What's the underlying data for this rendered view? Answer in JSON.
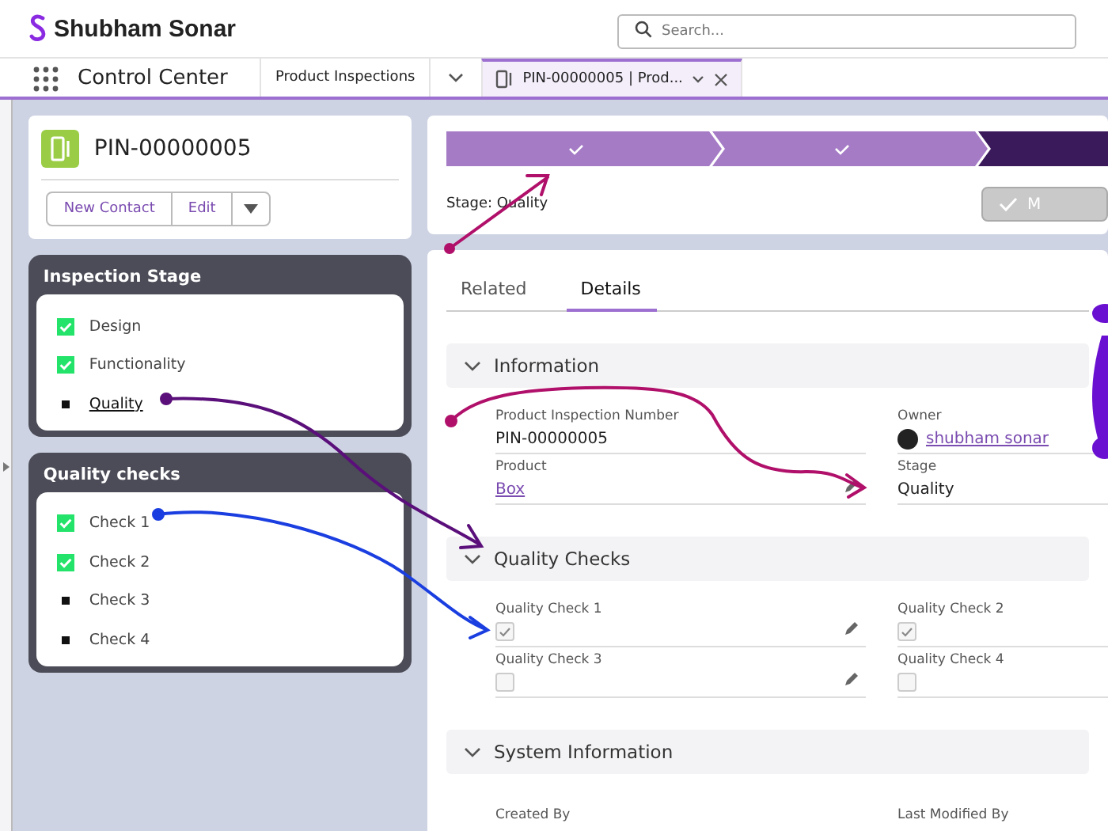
{
  "header": {
    "brand": "Shubham Sonar",
    "search": {
      "placeholder": "Search..."
    }
  },
  "nav": {
    "app_name": "Control Center",
    "tabs": [
      {
        "label": "Product Inspections",
        "selected": false,
        "kind": "object"
      },
      {
        "label": "PIN-00000005 | Prod...",
        "selected": true,
        "kind": "record"
      }
    ]
  },
  "record": {
    "title": "PIN-00000005",
    "buttons": [
      "New Contact",
      "Edit"
    ]
  },
  "panels": [
    {
      "title": "Inspection Stage",
      "items": [
        {
          "label": "Design",
          "checked": true,
          "current": false
        },
        {
          "label": "Functionality",
          "checked": true,
          "current": false
        },
        {
          "label": "Quality",
          "checked": false,
          "current": true
        }
      ]
    },
    {
      "title": "Quality checks",
      "items": [
        {
          "label": "Check 1",
          "checked": true,
          "current": false
        },
        {
          "label": "Check 2",
          "checked": true,
          "current": false
        },
        {
          "label": "Check 3",
          "checked": false,
          "current": false
        },
        {
          "label": "Check 4",
          "checked": false,
          "current": false
        }
      ]
    }
  ],
  "path": {
    "steps": [
      {
        "completed": true
      },
      {
        "completed": true
      },
      {
        "completed": false
      }
    ],
    "stage_text": "Stage: Quality",
    "button": {
      "label": "M",
      "disabled": true
    }
  },
  "detail_tabs": [
    {
      "label": "Related",
      "selected": false
    },
    {
      "label": "Details",
      "selected": true
    }
  ],
  "sections": [
    {
      "title": "Information",
      "fields": [
        {
          "label": "Product Inspection Number",
          "value": "PIN-00000005",
          "kind": "text",
          "editable": false
        },
        {
          "label": "Owner",
          "value": "shubham sonar",
          "kind": "user",
          "editable": false
        },
        {
          "label": "Product",
          "value": "Box",
          "kind": "link",
          "editable": true
        },
        {
          "label": "Stage",
          "value": "Quality",
          "kind": "text",
          "editable": false
        }
      ]
    },
    {
      "title": "Quality Checks",
      "fields": [
        {
          "label": "Quality Check 1",
          "kind": "checkbox",
          "checked": true,
          "editable": true
        },
        {
          "label": "Quality Check 2",
          "kind": "checkbox",
          "checked": true,
          "editable": false
        },
        {
          "label": "Quality Check 3",
          "kind": "checkbox",
          "checked": false,
          "editable": true
        },
        {
          "label": "Quality Check 4",
          "kind": "checkbox",
          "checked": false,
          "editable": false
        }
      ]
    },
    {
      "title": "System Information",
      "fields": [
        {
          "label": "Created By",
          "kind": "label",
          "editable": false
        },
        {
          "label": "Last Modified By",
          "kind": "label",
          "editable": false
        }
      ]
    }
  ]
}
